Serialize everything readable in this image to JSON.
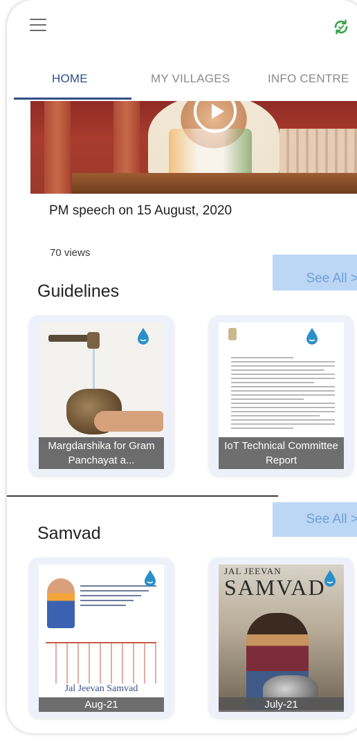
{
  "app": {
    "tabs": [
      {
        "label": "HOME",
        "active": true
      },
      {
        "label": "MY VILLAGES",
        "active": false
      },
      {
        "label": "INFO CENTRE",
        "active": false
      }
    ],
    "icons": {
      "menu": "hamburger-menu-icon",
      "sync": "sync-icon"
    },
    "colors": {
      "accent": "#2d4f86",
      "sync_green": "#3aa34a",
      "see_all_bg": "#bcd6f5",
      "see_all_text": "#6fa0d9"
    }
  },
  "video": {
    "title": "PM speech on 15 August, 2020",
    "views": "70 views"
  },
  "guidelines": {
    "title": "Guidelines",
    "see_all": "See All >",
    "cards": [
      {
        "caption": "Margdarshika for Gram Panchayat a..."
      },
      {
        "caption": "IoT Technical Committee Report"
      }
    ]
  },
  "samvad": {
    "title": "Samvad",
    "see_all": "See All >",
    "cards": [
      {
        "caption": "Aug-21",
        "poster_title": "Jal Jeevan Samvad"
      },
      {
        "caption": "July-21",
        "cover_line1": "JAL JEEVAN",
        "cover_line2": "SAMVAD"
      }
    ]
  }
}
